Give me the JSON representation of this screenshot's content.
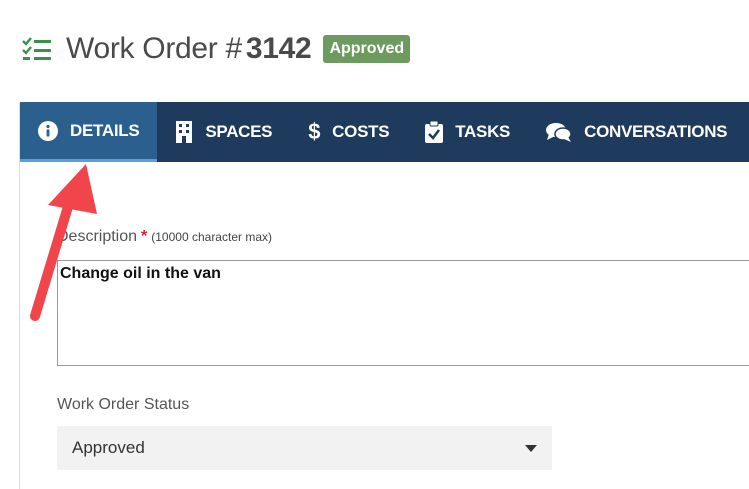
{
  "header": {
    "title_prefix": "Work Order #",
    "order_number": "3142",
    "status_badge": "Approved"
  },
  "tabs": [
    {
      "label": "DETAILS",
      "icon": "info-icon",
      "active": true
    },
    {
      "label": "SPACES",
      "icon": "building-icon",
      "active": false
    },
    {
      "label": "COSTS",
      "icon": "dollar-icon",
      "active": false
    },
    {
      "label": "TASKS",
      "icon": "clipboard-check-icon",
      "active": false
    },
    {
      "label": "CONVERSATIONS",
      "icon": "comments-icon",
      "active": false
    }
  ],
  "form": {
    "description": {
      "label": "Description",
      "required_mark": "*",
      "hint": "(10000 character max)",
      "value": "Change oil in the van"
    },
    "status": {
      "label": "Work Order Status",
      "selected": "Approved"
    }
  },
  "colors": {
    "tab_bar": "#1e3a5c",
    "tab_active": "#2b5f8e",
    "badge": "#6c9a5f",
    "annotation_arrow": "#f0454a"
  }
}
